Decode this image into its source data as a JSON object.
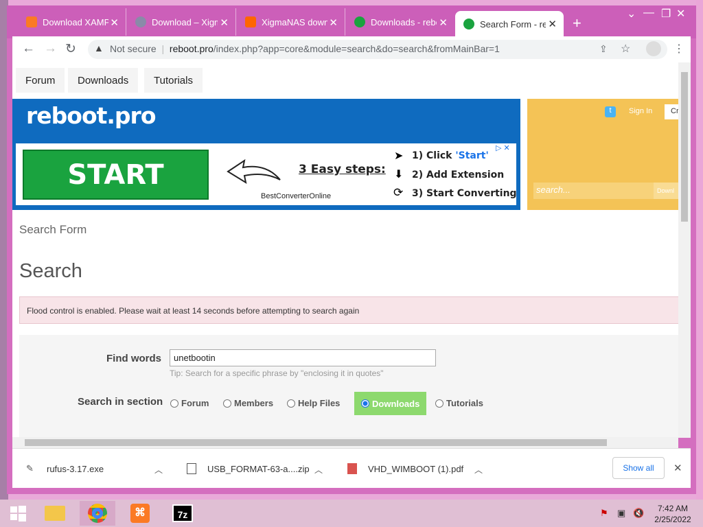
{
  "tabs": [
    {
      "label": "Download XAMPP",
      "icon": "xampp-icon",
      "color": "#fb7a24"
    },
    {
      "label": "Download – XigmaNAS",
      "icon": "xigmanas-icon",
      "color": "#8a8aa8"
    },
    {
      "label": "XigmaNAS download",
      "icon": "sourceforge-icon",
      "color": "#ff6600"
    },
    {
      "label": "Downloads - reboot.pro",
      "icon": "reboot-icon",
      "color": "#1aa33f"
    },
    {
      "label": "Search Form - reboot.pro",
      "icon": "reboot-icon",
      "color": "#1aa33f"
    }
  ],
  "toolbar": {
    "not_secure": "Not secure",
    "url_host": "reboot.pro",
    "url_path": "/index.php?app=core&module=search&do=search&fromMainBar=1"
  },
  "menu": [
    "Forum",
    "Downloads",
    "Tutorials"
  ],
  "banner": {
    "logo": "reboot.pro",
    "start_label": "START",
    "steps_title": "3 Easy steps:",
    "ad_brand": "BestConverterOnline",
    "step1": "1) Click ",
    "step1_hl": "'Start'",
    "step2": "2) Add Extension",
    "step3": "3) Start Converting"
  },
  "side": {
    "signin": "Sign In",
    "create": "Cr",
    "search_placeholder": "search...",
    "search_btn": "Downl"
  },
  "page": {
    "breadcrumb": "Search Form",
    "title": "Search",
    "flood": "Flood control is enabled. Please wait at least 14 seconds before attempting to search again"
  },
  "form": {
    "find_label": "Find words",
    "find_value": "unetbootin",
    "tip": "Tip: Search for a specific phrase by \"enclosing it in quotes\"",
    "section_label": "Search in section",
    "sections": [
      "Forum",
      "Members",
      "Help Files",
      "Downloads",
      "Tutorials"
    ],
    "selected": "Downloads"
  },
  "downloads": [
    {
      "name": "rufus-3.17.exe"
    },
    {
      "name": "USB_FORMAT-63-a....zip"
    },
    {
      "name": "VHD_WIMBOOT (1).pdf"
    }
  ],
  "show_all": "Show all",
  "clock": {
    "time": "7:42 AM",
    "date": "2/25/2022"
  }
}
